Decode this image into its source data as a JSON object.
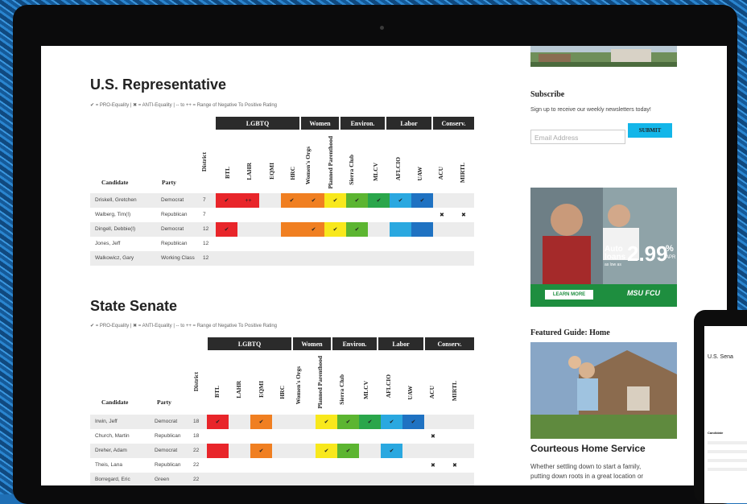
{
  "rep": {
    "title": "U.S. Representative",
    "legend": "✔ = PRO-Equality | ✖ = ANTI-Equality | -- to ++ = Range of Negative To Positive Rating",
    "groups": [
      "LGBTQ",
      "Women",
      "Environ.",
      "Labor",
      "Conserv."
    ],
    "headers": {
      "candidate": "Candidate",
      "party": "Party",
      "district": "District",
      "btl": "BTL",
      "lahr": "LAHR",
      "eqmi": "EQMI",
      "hrc": "HRC",
      "wo": "Women's Orgs",
      "pp": "Planned Parenthood",
      "sc": "Sierra Club",
      "mlcv": "MLCV",
      "aflcio": "AFLCIO",
      "uaw": "UAW",
      "acu": "ACU",
      "mirtl": "MIRTL"
    },
    "rows": [
      {
        "name": "Driskell, Gretchen",
        "party": "Democrat",
        "district": "7",
        "lahr": "++"
      },
      {
        "name": "Walberg, Tim(I)",
        "party": "Republican",
        "district": "7"
      },
      {
        "name": "Dingell, Debbie(I)",
        "party": "Democrat",
        "district": "12"
      },
      {
        "name": "Jones, Jeff",
        "party": "Republican",
        "district": "12"
      },
      {
        "name": "Walkowicz, Gary",
        "party": "Working Class",
        "district": "12"
      }
    ]
  },
  "senate": {
    "title": "State Senate",
    "legend": "✔ = PRO-Equality | ✖ = ANTI-Equality | -- to ++ = Range of Negative To Positive Rating",
    "groups": [
      "LGBTQ",
      "Women",
      "Environ.",
      "Labor",
      "Conserv."
    ],
    "rows": [
      {
        "name": "Irwin, Jeff",
        "party": "Democrat",
        "district": "18"
      },
      {
        "name": "Church, Martin",
        "party": "Republican",
        "district": "18"
      },
      {
        "name": "Dreher, Adam",
        "party": "Democrat",
        "district": "22"
      },
      {
        "name": "Theis, Lana",
        "party": "Republican",
        "district": "22"
      },
      {
        "name": "Borregard, Eric",
        "party": "Green",
        "district": "22"
      }
    ]
  },
  "marks": {
    "check": "✔",
    "cross": "✖"
  },
  "sidebar": {
    "subscribe_title": "Subscribe",
    "subscribe_text": "Sign up to receive our weekly newsletters today!",
    "email_placeholder": "Email Address",
    "submit_label": "SUBMIT",
    "ad": {
      "line1": "Auto",
      "line2": "loans",
      "line3": "as low as",
      "rate": "2.99",
      "unit": "%",
      "apr": "APR",
      "cta": "LEARN MORE",
      "brand": "MSU FCU"
    },
    "guide_title": "Featured Guide: Home",
    "guide_heading": "Courteous Home Service",
    "guide_text1": "Whether settling down to start a family,",
    "guide_text2": "putting down roots in a great location or"
  },
  "phone": {
    "title": "U.S. Sena",
    "col": "Candidate"
  },
  "colors": {
    "red": "#e8252a",
    "orange": "#f07f21",
    "yellow": "#f8e81c",
    "green": "#5cb531",
    "green2": "#2aa64b",
    "blue": "#2aa8e0",
    "blue2": "#1f72c2",
    "white": "#ffffff"
  }
}
